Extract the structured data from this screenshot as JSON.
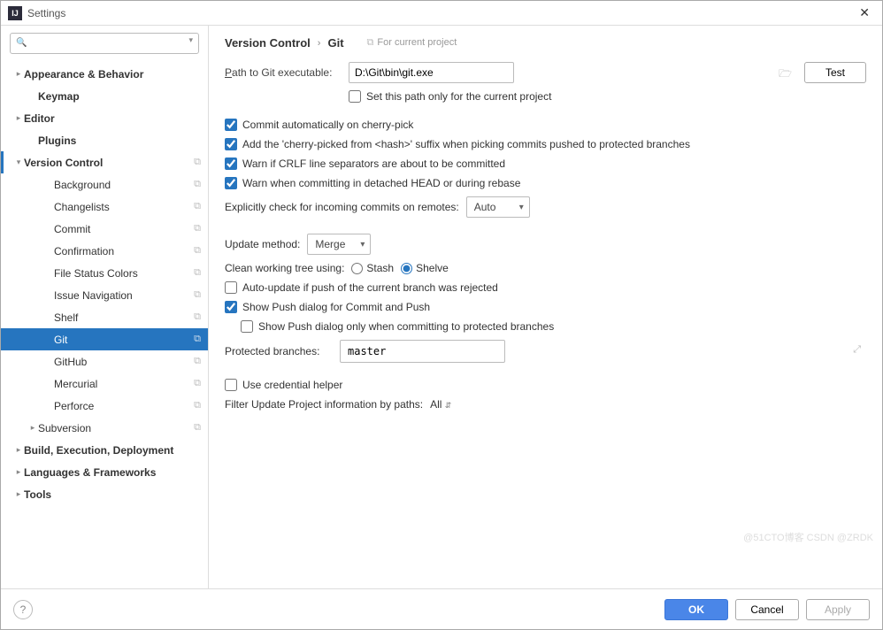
{
  "window": {
    "title": "Settings",
    "close": "✕"
  },
  "search": {
    "placeholder": ""
  },
  "sidebar": {
    "items": [
      {
        "label": "Appearance & Behavior",
        "bold": true,
        "level": 0,
        "arrow": "▸"
      },
      {
        "label": "Keymap",
        "bold": true,
        "level": 1
      },
      {
        "label": "Editor",
        "bold": true,
        "level": 0,
        "arrow": "▸"
      },
      {
        "label": "Plugins",
        "bold": true,
        "level": 1
      },
      {
        "label": "Version Control",
        "bold": true,
        "level": 0,
        "arrow": "▾",
        "copy": true,
        "marker": true
      },
      {
        "label": "Background",
        "level": 2,
        "copy": true
      },
      {
        "label": "Changelists",
        "level": 2,
        "copy": true
      },
      {
        "label": "Commit",
        "level": 2,
        "copy": true
      },
      {
        "label": "Confirmation",
        "level": 2,
        "copy": true
      },
      {
        "label": "File Status Colors",
        "level": 2,
        "copy": true
      },
      {
        "label": "Issue Navigation",
        "level": 2,
        "copy": true
      },
      {
        "label": "Shelf",
        "level": 2,
        "copy": true
      },
      {
        "label": "Git",
        "level": 2,
        "copy": true,
        "selected": true
      },
      {
        "label": "GitHub",
        "level": 2,
        "copy": true
      },
      {
        "label": "Mercurial",
        "level": 2,
        "copy": true
      },
      {
        "label": "Perforce",
        "level": 2,
        "copy": true
      },
      {
        "label": "Subversion",
        "level": 1,
        "arrow": "▸",
        "copy": true
      },
      {
        "label": "Build, Execution, Deployment",
        "bold": true,
        "level": 0,
        "arrow": "▸"
      },
      {
        "label": "Languages & Frameworks",
        "bold": true,
        "level": 0,
        "arrow": "▸"
      },
      {
        "label": "Tools",
        "bold": true,
        "level": 0,
        "arrow": "▸"
      }
    ]
  },
  "breadcrumb": {
    "a": "Version Control",
    "sep": "›",
    "b": "Git",
    "hint": "For current project"
  },
  "form": {
    "path_label_pre": "P",
    "path_label_rest": "ath to Git executable:",
    "path_value": "D:\\Git\\bin\\git.exe",
    "test_btn": "Test",
    "set_path_only": "Set this path only for the current project",
    "commit_auto": "Commit automatically on cherry-pick",
    "add_suffix": "Add the 'cherry-picked from <hash>' suffix when picking commits pushed to protected branches",
    "warn_crlf": "Warn if CRLF line separators are about to be committed",
    "warn_detached": "Warn when committing in detached HEAD or during rebase",
    "explicit_check_label": "Explicitly check for incoming commits on remotes:",
    "explicit_check_value": "Auto",
    "update_method_label": "Update method:",
    "update_method_value": "Merge",
    "clean_tree_label": "Clean working tree using:",
    "stash": "Stash",
    "shelve": "Shelve",
    "auto_update": "Auto-update if push of the current branch was rejected",
    "show_push": "Show Push dialog for Commit and Push",
    "show_push_only": "Show Push dialog only when committing to protected branches",
    "protected_label": "Protected branches:",
    "protected_value": "master",
    "use_cred": "Use credential helper",
    "filter_label": "Filter Update Project information by paths:",
    "filter_value": "All"
  },
  "footer": {
    "help": "?",
    "ok": "OK",
    "cancel": "Cancel",
    "apply": "Apply"
  },
  "watermark": "@51CTO博客\nCSDN @ZRDK"
}
